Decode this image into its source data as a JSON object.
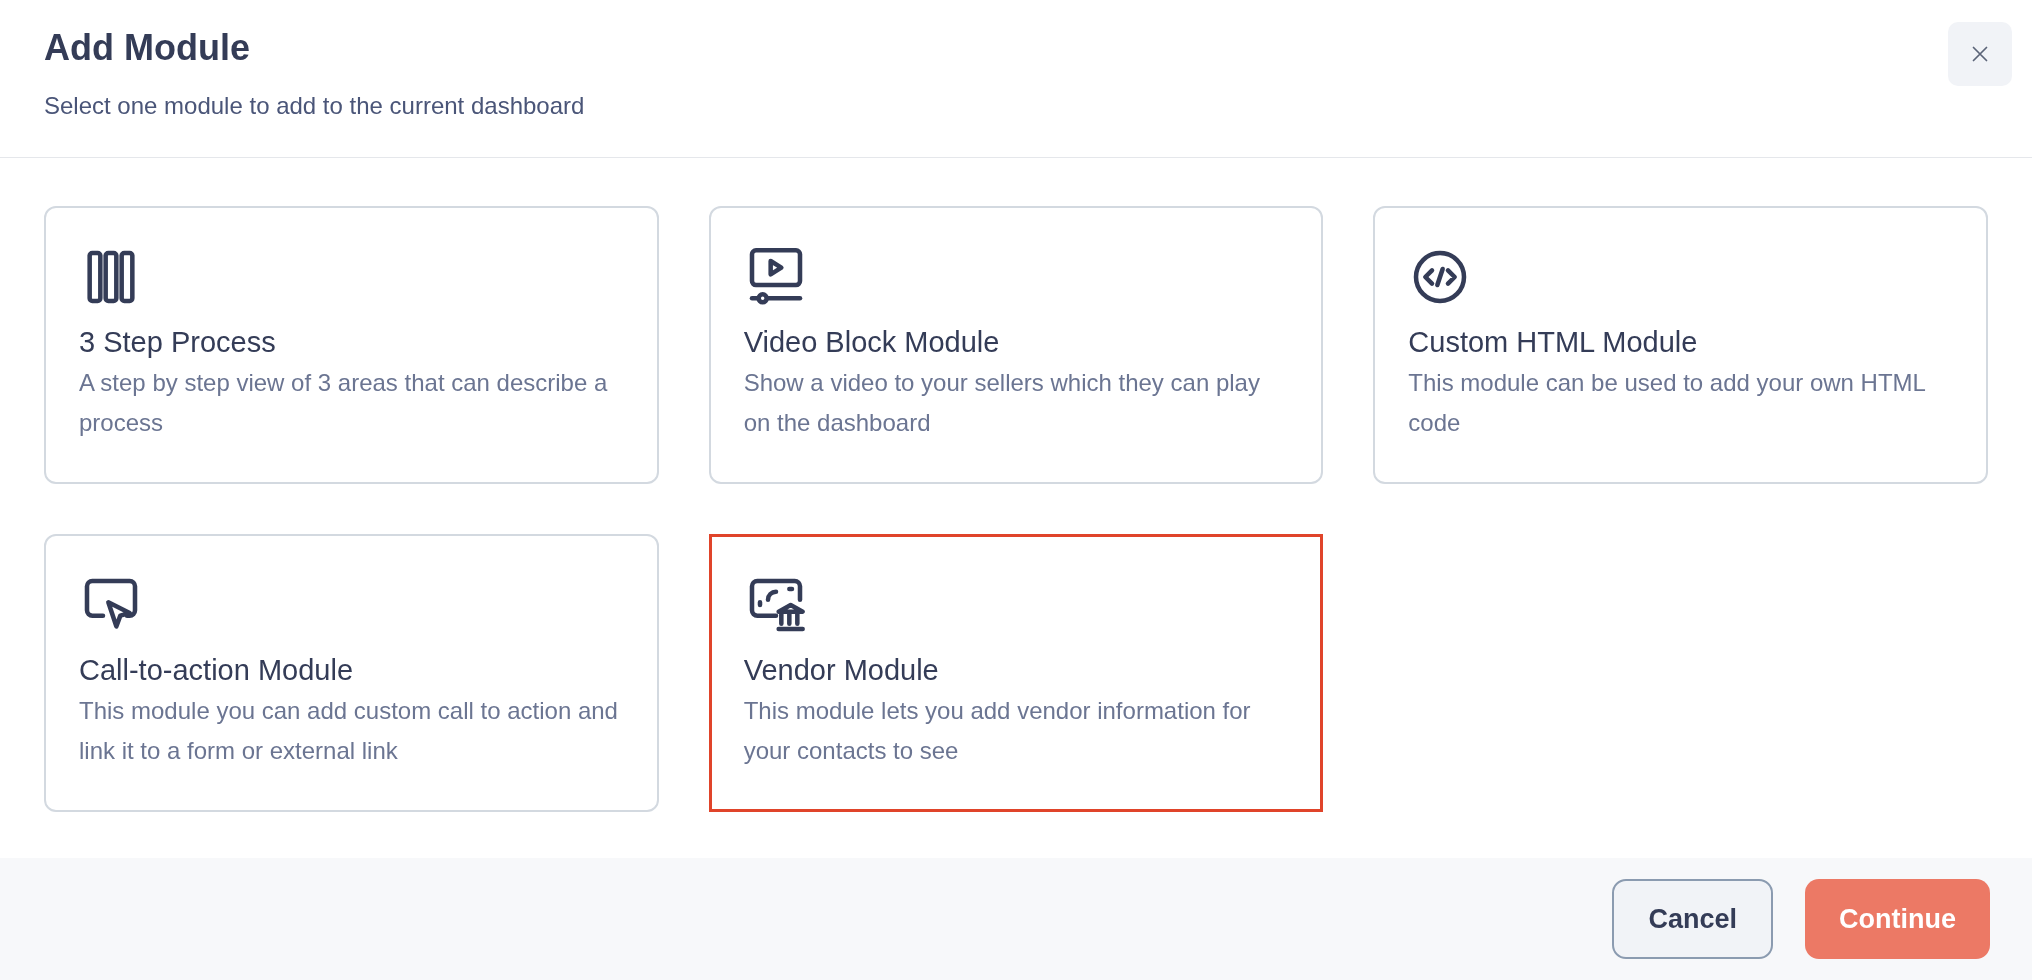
{
  "dialog": {
    "title": "Add Module",
    "subtitle": "Select one module to add to the current dashboard"
  },
  "modules": [
    {
      "kind": "steps",
      "title": "3 Step Process",
      "description": "A step by step view of 3 areas that can describe a process",
      "selected": false
    },
    {
      "kind": "video",
      "title": "Video Block Module",
      "description": "Show a video to your sellers which they can play on the dashboard",
      "selected": false
    },
    {
      "kind": "code",
      "title": "Custom HTML Module",
      "description": "This module can be used to add your own HTML code",
      "selected": false
    },
    {
      "kind": "cta",
      "title": "Call-to-action Module",
      "description": "This module you can add custom call to action and link it to a form or external link",
      "selected": false
    },
    {
      "kind": "vendor",
      "title": "Vendor Module",
      "description": "This module lets you add vendor information for your contacts to see",
      "selected": true
    }
  ],
  "buttons": {
    "cancel": "Cancel",
    "continue": "Continue"
  }
}
